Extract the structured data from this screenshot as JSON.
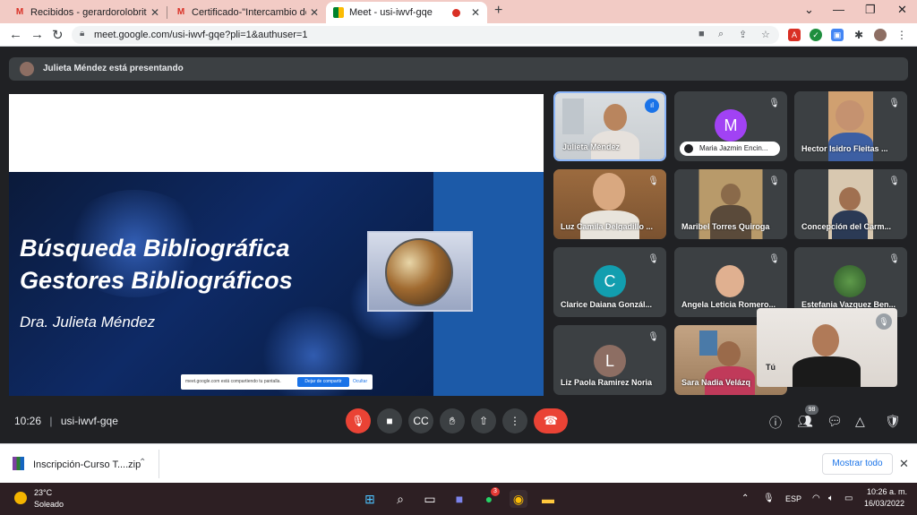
{
  "browser": {
    "tabs": [
      {
        "title": "Recibidos - gerardorolobritez@g",
        "icon": "gmail-icon"
      },
      {
        "title": "Certificado-\"Intercambio de Expe",
        "icon": "gmail-icon"
      },
      {
        "title": "Meet - usi-iwvf-gqe",
        "icon": "meet-icon",
        "active": true
      }
    ],
    "url": "meet.google.com/usi-iwvf-gqe?pli=1&authuser=1"
  },
  "meet": {
    "presenting_text": "Julieta Méndez está presentando",
    "slide": {
      "line1": "Búsqueda Bibliográfica",
      "line2": "Gestores Bibliográficos",
      "author": "Dra. Julieta Méndez",
      "share_bar_text": "meet.google.com está compartiendo tu pantalla.",
      "stop_label": "Dejar de compartir",
      "hide_label": "Ocultar"
    },
    "participants": [
      {
        "name": "Julieta Méndez",
        "type": "video",
        "speaking": true
      },
      {
        "name": "Maria Jazmin Encin...",
        "type": "avatar",
        "initial": "M",
        "color": "#a142f4"
      },
      {
        "name": "Hector Isidro Fleitas ...",
        "type": "video"
      },
      {
        "name": "Luz Camila Delgadillo ...",
        "type": "video"
      },
      {
        "name": "Maribel Torres Quiroga",
        "type": "video"
      },
      {
        "name": "Concepción del Carm...",
        "type": "video"
      },
      {
        "name": "Clarice Daiana Gonzál...",
        "type": "avatar",
        "initial": "C",
        "color": "#129eaf"
      },
      {
        "name": "Angela Leticia Romero...",
        "type": "video"
      },
      {
        "name": "Estefania Vazquez Ben...",
        "type": "video"
      },
      {
        "name": "Liz Paola Ramirez Noria",
        "type": "avatar",
        "initial": "L",
        "color": "#8d6e63"
      },
      {
        "name": "Sara Nadia Velázq",
        "type": "video"
      }
    ],
    "self_label": "Tú",
    "time": "10:26",
    "meeting_code": "usi-iwvf-gqe",
    "participant_count": "98"
  },
  "download": {
    "filename": "Inscripción-Curso T....zip",
    "show_all": "Mostrar todo"
  },
  "taskbar": {
    "temperature": "23°C",
    "weather": "Soleado",
    "whatsapp_badge": "3",
    "lang": "ESP",
    "time": "10:26 a. m.",
    "date": "16/03/2022"
  }
}
